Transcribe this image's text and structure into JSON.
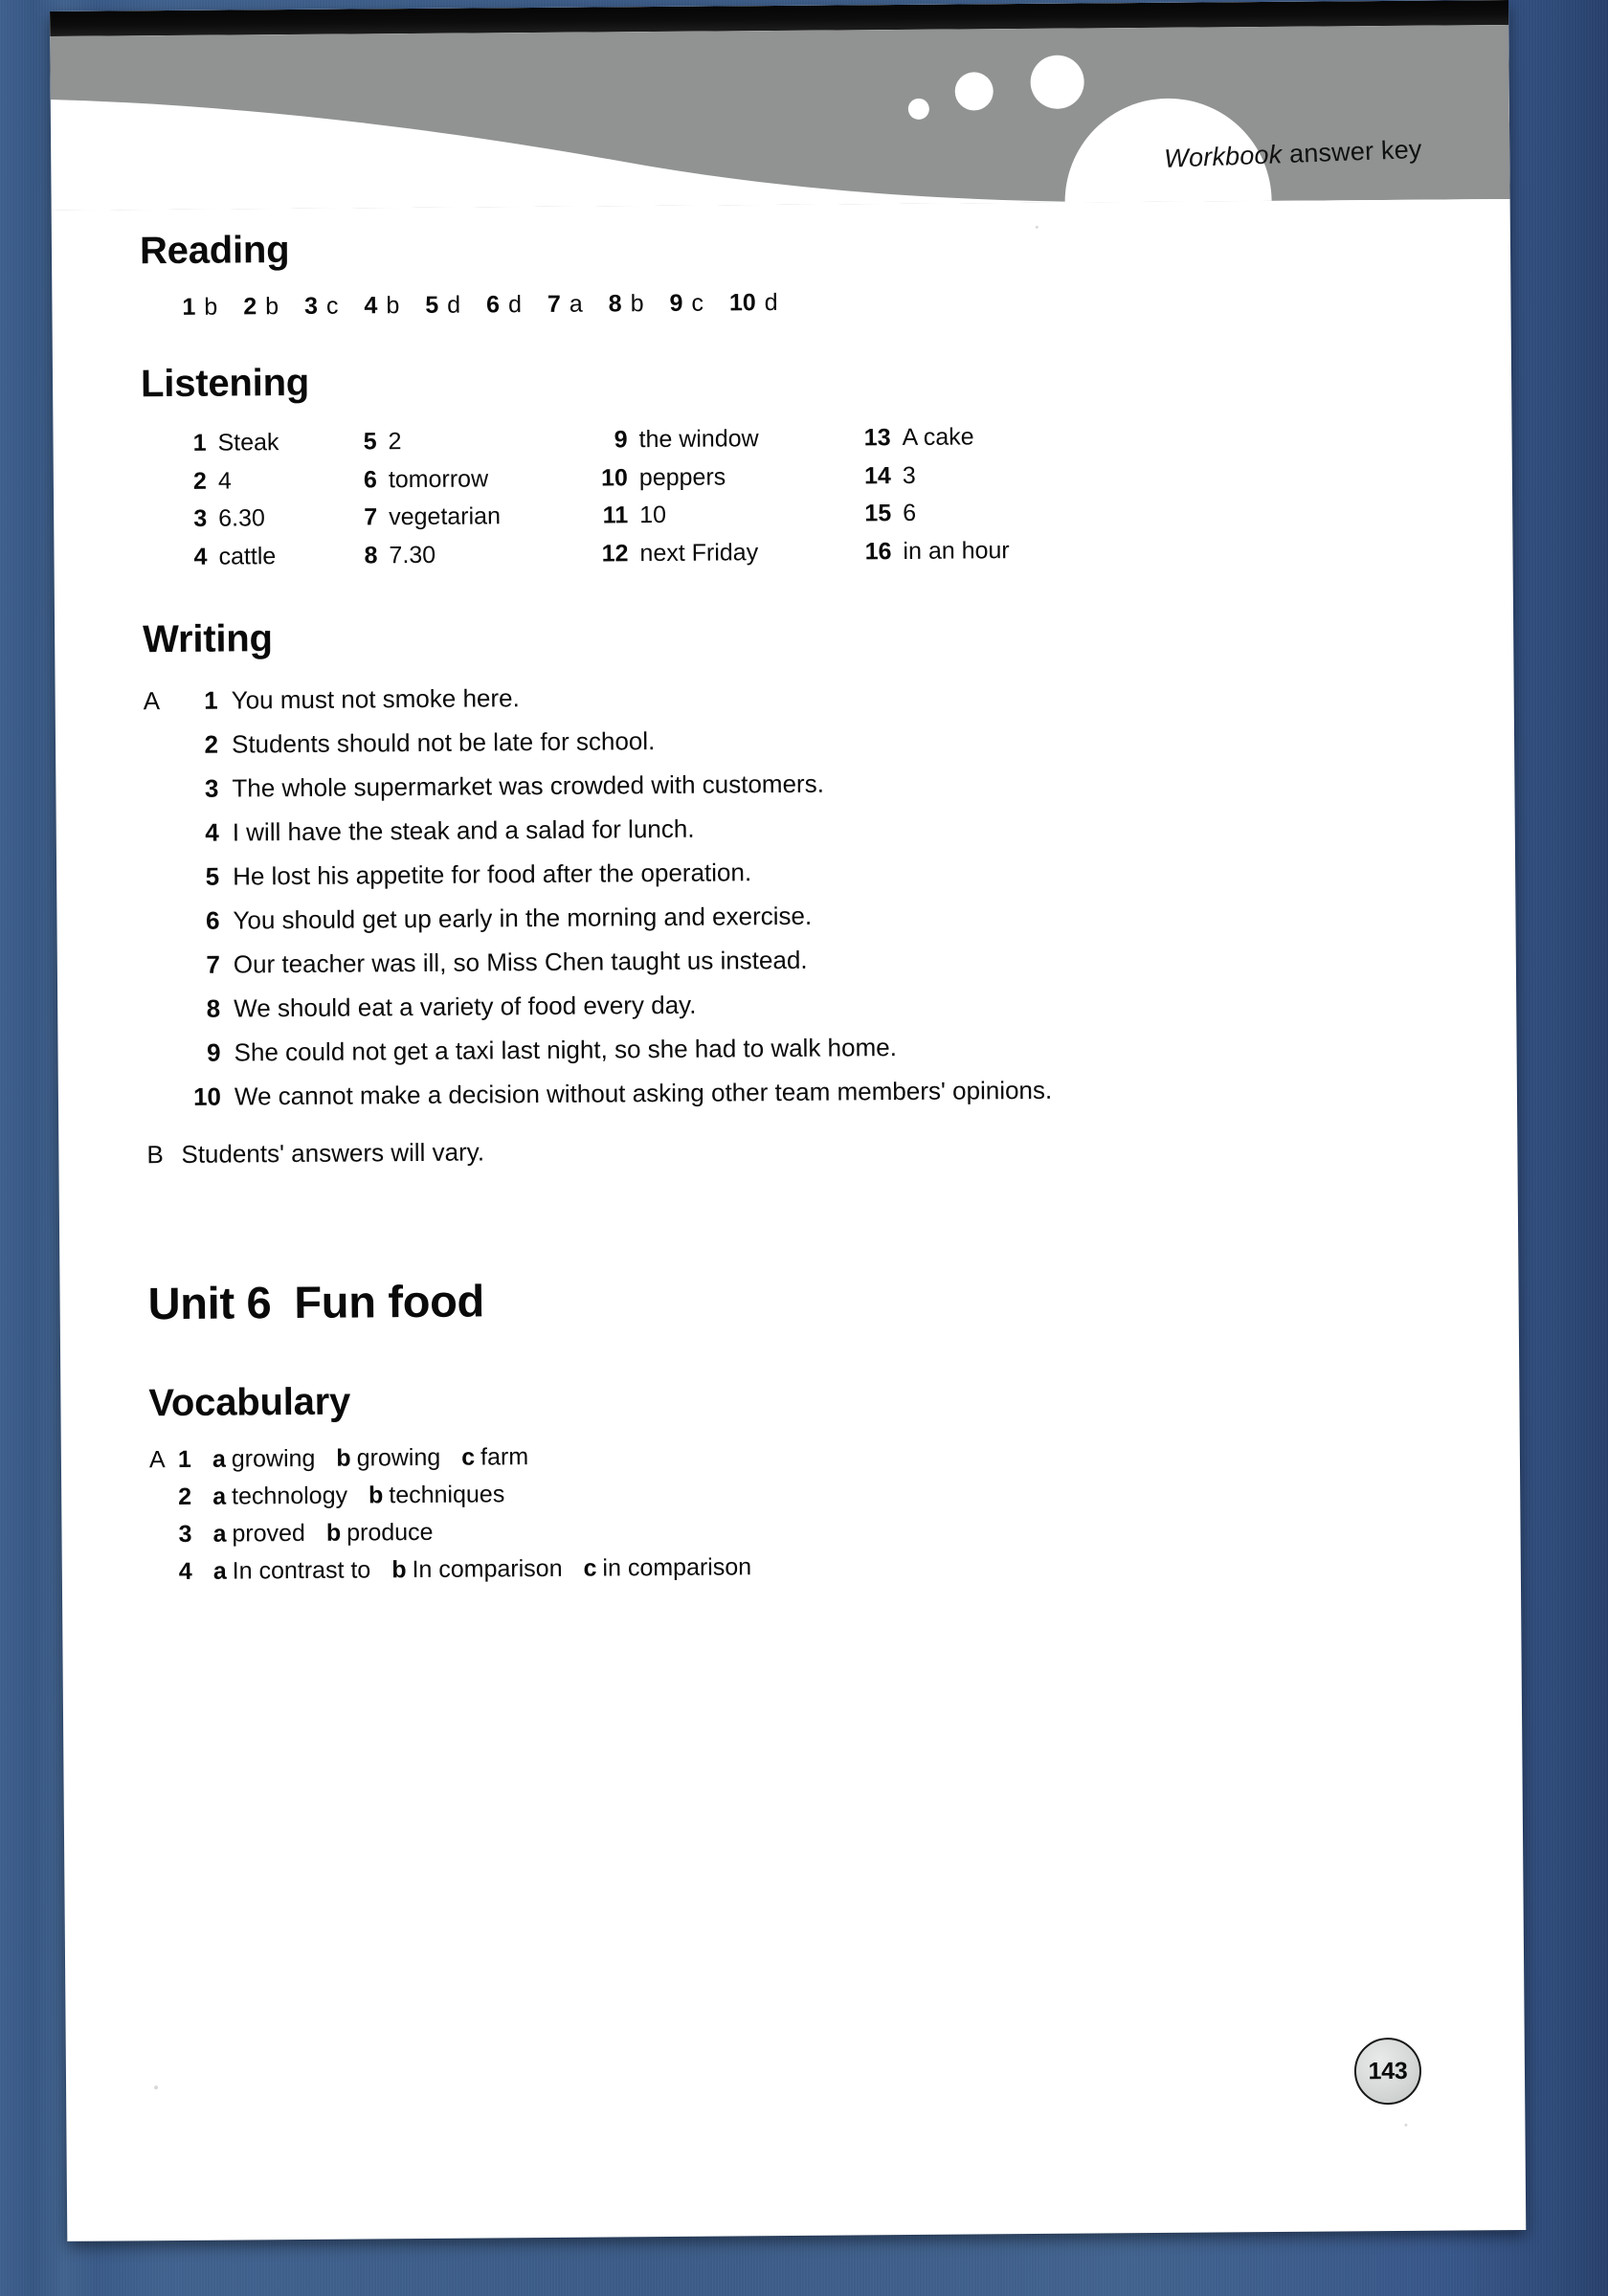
{
  "banner": {
    "title_italic": "Workbook",
    "title_roman": " answer key"
  },
  "sections": {
    "reading": {
      "heading": "Reading",
      "answers": [
        {
          "num": "1",
          "ans": "b"
        },
        {
          "num": "2",
          "ans": "b"
        },
        {
          "num": "3",
          "ans": "c"
        },
        {
          "num": "4",
          "ans": "b"
        },
        {
          "num": "5",
          "ans": "d"
        },
        {
          "num": "6",
          "ans": "d"
        },
        {
          "num": "7",
          "ans": "a"
        },
        {
          "num": "8",
          "ans": "b"
        },
        {
          "num": "9",
          "ans": "c"
        },
        {
          "num": "10",
          "ans": "d"
        }
      ]
    },
    "listening": {
      "heading": "Listening",
      "answers": [
        {
          "num": "1",
          "ans": "Steak"
        },
        {
          "num": "5",
          "ans": "2"
        },
        {
          "num": "9",
          "ans": "the window"
        },
        {
          "num": "13",
          "ans": "A cake"
        },
        {
          "num": "2",
          "ans": "4"
        },
        {
          "num": "6",
          "ans": "tomorrow"
        },
        {
          "num": "10",
          "ans": "peppers"
        },
        {
          "num": "14",
          "ans": "3"
        },
        {
          "num": "3",
          "ans": "6.30"
        },
        {
          "num": "7",
          "ans": "vegetarian"
        },
        {
          "num": "11",
          "ans": "10"
        },
        {
          "num": "15",
          "ans": "6"
        },
        {
          "num": "4",
          "ans": "cattle"
        },
        {
          "num": "8",
          "ans": "7.30"
        },
        {
          "num": "12",
          "ans": "next Friday"
        },
        {
          "num": "16",
          "ans": "in an hour"
        }
      ]
    },
    "writing": {
      "heading": "Writing",
      "part_a_letter": "A",
      "part_a": [
        {
          "num": "1",
          "text": "You must not smoke here."
        },
        {
          "num": "2",
          "text": "Students should not be late for school."
        },
        {
          "num": "3",
          "text": "The whole supermarket was crowded with customers."
        },
        {
          "num": "4",
          "text": "I will have the steak and a salad for lunch."
        },
        {
          "num": "5",
          "text": "He lost his appetite for food after the operation."
        },
        {
          "num": "6",
          "text": "You should get up early in the morning and exercise."
        },
        {
          "num": "7",
          "text": "Our teacher was ill, so Miss Chen taught us instead."
        },
        {
          "num": "8",
          "text": "We should eat a variety of food every day."
        },
        {
          "num": "9",
          "text": "She could not get a taxi last night, so she had to walk home."
        },
        {
          "num": "10",
          "text": "We cannot make a decision without asking other team members' opinions."
        }
      ],
      "part_b_letter": "B",
      "part_b_text": "Students' answers will vary."
    },
    "unit": {
      "label": "Unit 6",
      "title": "Fun food"
    },
    "vocabulary": {
      "heading": "Vocabulary",
      "part_a_letter": "A",
      "items": [
        {
          "num": "1",
          "options": [
            {
              "key": "a",
              "word": "growing"
            },
            {
              "key": "b",
              "word": "growing"
            },
            {
              "key": "c",
              "word": "farm"
            }
          ]
        },
        {
          "num": "2",
          "options": [
            {
              "key": "a",
              "word": "technology"
            },
            {
              "key": "b",
              "word": "techniques"
            }
          ]
        },
        {
          "num": "3",
          "options": [
            {
              "key": "a",
              "word": "proved"
            },
            {
              "key": "b",
              "word": "produce"
            }
          ]
        },
        {
          "num": "4",
          "options": [
            {
              "key": "a",
              "word": "In contrast to"
            },
            {
              "key": "b",
              "word": "In comparison"
            },
            {
              "key": "c",
              "word": "in comparison"
            }
          ]
        }
      ]
    }
  },
  "page_number": "143",
  "colors": {
    "desk_blue": "#3c5c88",
    "banner_grey": "#8d8f8f",
    "paper_white": "#ffffff",
    "ink_black": "#0a0a0a",
    "badge_grey": "#d6d8d8"
  }
}
